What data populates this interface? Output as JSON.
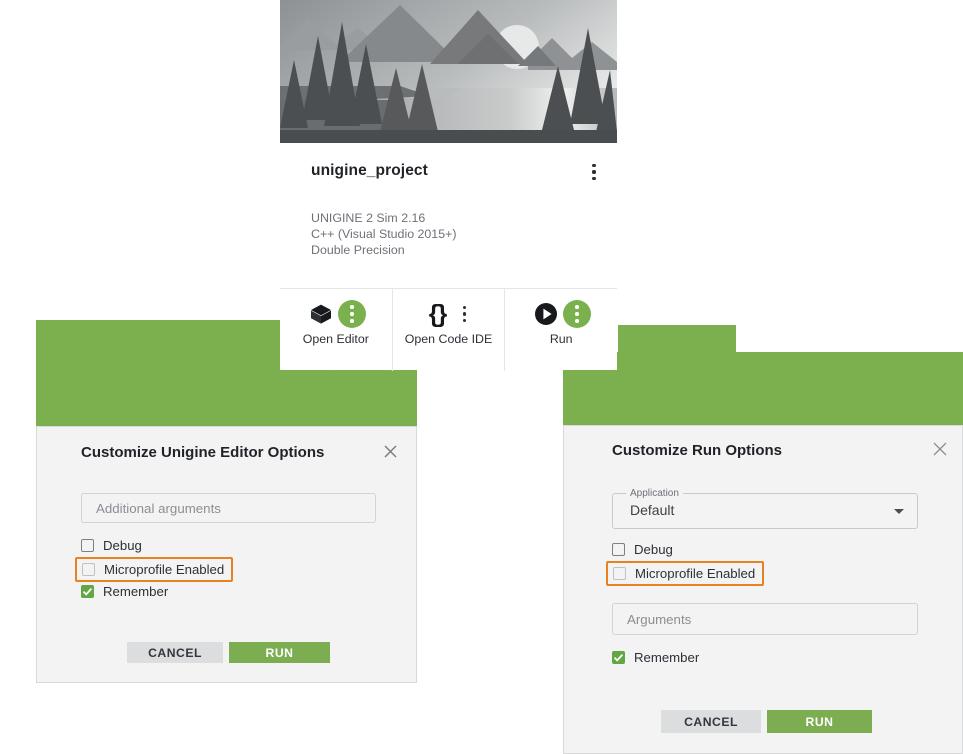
{
  "project_card": {
    "thumbnail_alt": "grayscale mountain lake forest landscape",
    "title": "unigine_project",
    "menu_icon": "more-vert-icon",
    "meta": [
      "UNIGINE 2 Sim 2.16",
      "C++ (Visual Studio 2015+)",
      "Double Precision"
    ],
    "actions": [
      {
        "label": "Open Editor",
        "icon": "cube-icon",
        "menu_icon": "more-vert-icon",
        "menu_highlighted": true
      },
      {
        "label": "Open Code IDE",
        "icon": "braces-icon",
        "menu_icon": "more-vert-icon",
        "menu_highlighted": false,
        "braces_glyph": "{}"
      },
      {
        "label": "Run",
        "icon": "play-icon",
        "menu_icon": "more-vert-icon",
        "menu_highlighted": true
      }
    ]
  },
  "dialog_editor": {
    "title": "Customize Unigine Editor Options",
    "close_icon": "close-icon",
    "arguments_placeholder": "Additional arguments",
    "arguments_value": "",
    "checkboxes": [
      {
        "label": "Debug",
        "checked": false,
        "highlighted": false
      },
      {
        "label": "Microprofile Enabled",
        "checked": false,
        "highlighted": true
      },
      {
        "label": "Remember",
        "checked": true,
        "highlighted": false
      }
    ],
    "cancel_label": "CANCEL",
    "run_label": "RUN"
  },
  "dialog_run": {
    "title": "Customize Run Options",
    "close_icon": "close-icon",
    "application_label": "Application",
    "application_value": "Default",
    "dropdown_icon": "chevron-down-icon",
    "arguments_placeholder": "Arguments",
    "arguments_value": "",
    "checkboxes": [
      {
        "label": "Debug",
        "checked": false,
        "highlighted": false
      },
      {
        "label": "Microprofile Enabled",
        "checked": false,
        "highlighted": true
      },
      {
        "label": "Remember",
        "checked": true,
        "highlighted": false
      }
    ],
    "cancel_label": "CANCEL",
    "run_label": "RUN"
  },
  "colors": {
    "accent_green": "#7cb04f",
    "button_green": "#7cae51",
    "checkbox_green": "#62a744",
    "highlight_orange": "#e8821f",
    "cancel_gray": "#dcdddf",
    "dialog_bg": "#f3f3f4",
    "text_primary": "#1f2226",
    "text_secondary": "#6d7278"
  }
}
